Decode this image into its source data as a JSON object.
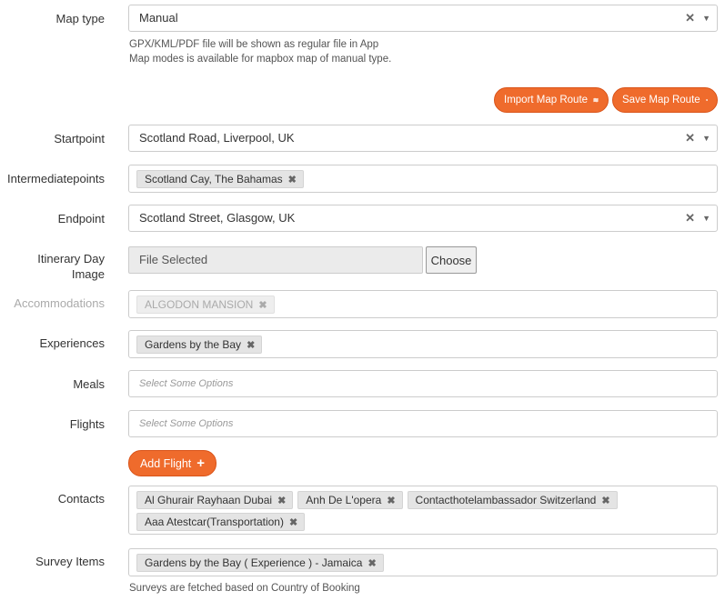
{
  "map_type": {
    "label": "Map type",
    "value": "Manual",
    "help_line1": "GPX/KML/PDF file will be shown as regular file in App",
    "help_line2": "Map modes is available for mapbox map of manual type."
  },
  "buttons": {
    "import_map_route": "Import Map Route",
    "save_map_route": "Save Map Route",
    "add_flight": "Add Flight"
  },
  "startpoint": {
    "label": "Startpoint",
    "value": "Scotland Road, Liverpool, UK"
  },
  "intermediate": {
    "label": "Intermediatepoints",
    "chips": [
      "Scotland Cay, The Bahamas"
    ]
  },
  "endpoint": {
    "label": "Endpoint",
    "value": "Scotland Street, Glasgow, UK"
  },
  "itinerary_image": {
    "label_line1": "Itinerary Day",
    "label_line2": "Image",
    "file_text": "File Selected",
    "choose_label": "Choose"
  },
  "accommodations": {
    "label": "Accommodations",
    "chips": [
      "ALGODON MANSION"
    ]
  },
  "experiences": {
    "label": "Experiences",
    "chips": [
      "Gardens by the Bay"
    ]
  },
  "meals": {
    "label": "Meals",
    "placeholder": "Select Some Options"
  },
  "flights": {
    "label": "Flights",
    "placeholder": "Select Some Options"
  },
  "contacts": {
    "label": "Contacts",
    "chips": [
      "Al Ghurair Rayhaan Dubai",
      "Anh De L'opera",
      "Contacthotelambassador Switzerland",
      "Aaa Atestcar(Transportation)"
    ]
  },
  "survey_items": {
    "label": "Survey Items",
    "chips": [
      "Gardens by the Bay ( Experience ) - Jamaica"
    ],
    "help": "Surveys are fetched based on Country of Booking"
  },
  "icons": {
    "clear": "✕",
    "dropdown": "▼",
    "chip_remove": "✖",
    "plus": "+"
  },
  "colors": {
    "accent": "#ef6b2c"
  }
}
